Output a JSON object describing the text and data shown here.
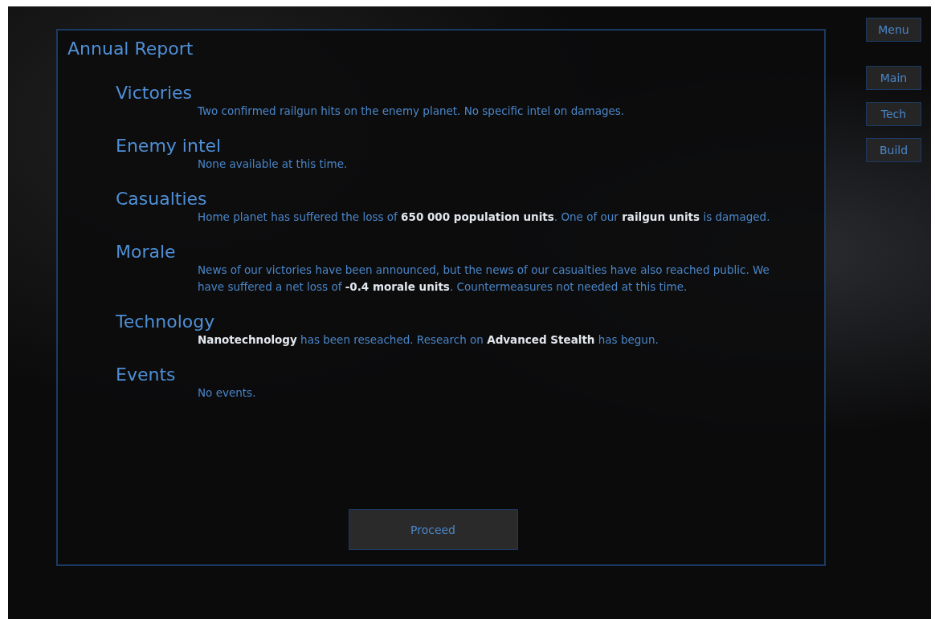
{
  "side_menu": [
    {
      "label": "Menu"
    },
    {
      "label": "Main"
    },
    {
      "label": "Tech"
    },
    {
      "label": "Build"
    }
  ],
  "report": {
    "title": "Annual Report",
    "sections": [
      {
        "heading": "Victories",
        "text": "Two confirmed railgun hits on the enemy planet. No specific intel on damages."
      },
      {
        "heading": "Enemy intel",
        "text": "None available at this time."
      },
      {
        "heading": "Casualties",
        "text": "Home planet has suffered the loss of **650 000 population units**. One of our **railgun units** is damaged."
      },
      {
        "heading": "Morale",
        "text": "News of our victories have been announced, but the news of our casualties have also reached public. We have suffered a net loss of **-0.4 morale units**. Countermeasures not needed at this time."
      },
      {
        "heading": "Technology",
        "text": "**Nanotechnology** has been reseached. Research on **Advanced Stealth** has begun."
      },
      {
        "heading": "Events",
        "text": "No events."
      }
    ],
    "button": "Proceed"
  }
}
